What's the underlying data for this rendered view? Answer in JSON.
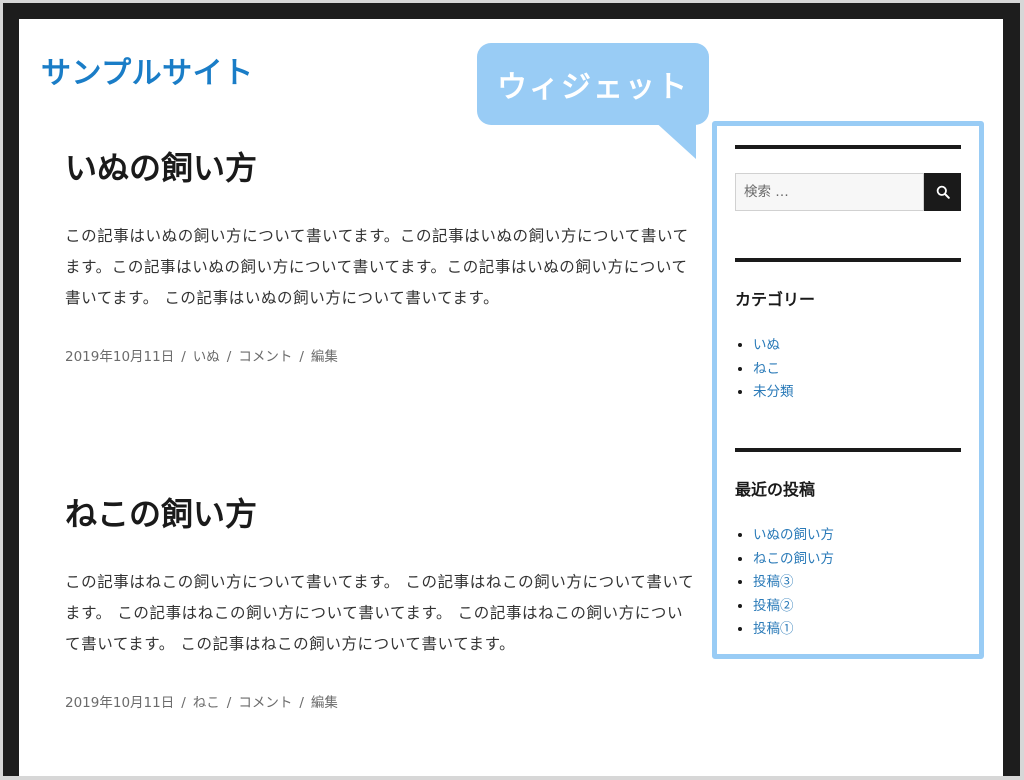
{
  "site": {
    "title": "サンプルサイト"
  },
  "callout": {
    "label": "ウィジェット",
    "color": "#99ccf5"
  },
  "posts": [
    {
      "title": "いぬの飼い方",
      "body": "この記事はいぬの飼い方について書いてます。この記事はいぬの飼い方について書いてます。この記事はいぬの飼い方について書いてます。この記事はいぬの飼い方について書いてます。 この記事はいぬの飼い方について書いてます。",
      "date": "2019年10月11日",
      "category": "いぬ",
      "comment": "コメント",
      "edit": "編集"
    },
    {
      "title": "ねこの飼い方",
      "body": "この記事はねこの飼い方について書いてます。 この記事はねこの飼い方について書いてます。 この記事はねこの飼い方について書いてます。 この記事はねこの飼い方について書いてます。 この記事はねこの飼い方について書いてます。",
      "date": "2019年10月11日",
      "category": "ねこ",
      "comment": "コメント",
      "edit": "編集"
    }
  ],
  "meta_separator": "/",
  "sidebar": {
    "search": {
      "placeholder": "検索 …",
      "icon": "search-icon"
    },
    "categories": {
      "title": "カテゴリー",
      "items": [
        "いぬ",
        "ねこ",
        "未分類"
      ]
    },
    "recent_posts": {
      "title": "最近の投稿",
      "items": [
        "いぬの飼い方",
        "ねこの飼い方",
        "投稿③",
        "投稿②",
        "投稿①"
      ]
    }
  },
  "colors": {
    "site_title": "#1a7dc7",
    "link": "#2a7ab8",
    "highlight": "#99ccf5",
    "frame": "#1d1d1d"
  }
}
